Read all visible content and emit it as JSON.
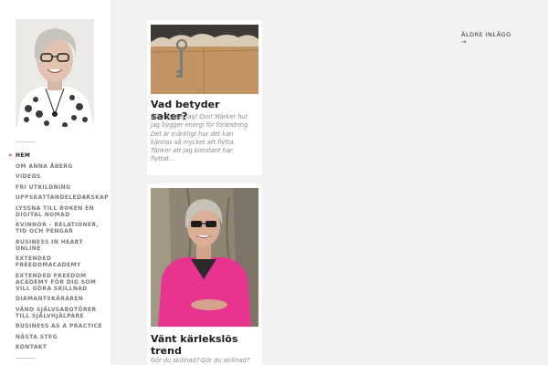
{
  "nav": {
    "items": [
      {
        "label": "Hem",
        "active": true
      },
      {
        "label": "Om Anna Åberg",
        "active": false
      },
      {
        "label": "Videos",
        "active": false
      },
      {
        "label": "Fri utbildning",
        "active": false
      },
      {
        "label": "Uppskattandeledarskap",
        "active": false
      },
      {
        "label": "Lyssna till boken en digital nomad",
        "active": false
      },
      {
        "label": "Kvinnor – relationer, tid och pengar",
        "active": false
      },
      {
        "label": "Business in heart online",
        "active": false
      },
      {
        "label": "Extended freedomacademy",
        "active": false
      },
      {
        "label": "Extended Freedom Academy för dig som vill göra skillnad",
        "active": false
      },
      {
        "label": "Diamantskäraren",
        "active": false
      },
      {
        "label": "Vänd självsabotörer till självhjälpare",
        "active": false
      },
      {
        "label": "Business as a practice",
        "active": false
      },
      {
        "label": "Nästa steg",
        "active": false
      },
      {
        "label": "Kontakt",
        "active": false
      }
    ]
  },
  "posts": [
    {
      "title": "Vad betyder saker?",
      "excerpt": "Idag flyttar jag! Oro! Märker hur jag bygger energi för förändring. Det är märkligt hur det kan kännas så mycket att flytta. Tänker att jag konstant har flyttat…"
    },
    {
      "title": "Vänt kärlekslös trend",
      "excerpt": "Gör du skillnad? Gör du skillnad?"
    }
  ],
  "pagination": {
    "older_label": "Äldre inlägg",
    "older_arrow": "→"
  },
  "colors": {
    "background": "#f1f1f1",
    "sidebar": "#ffffff",
    "accent": "#d04040",
    "cardigan": "#e8338f"
  }
}
